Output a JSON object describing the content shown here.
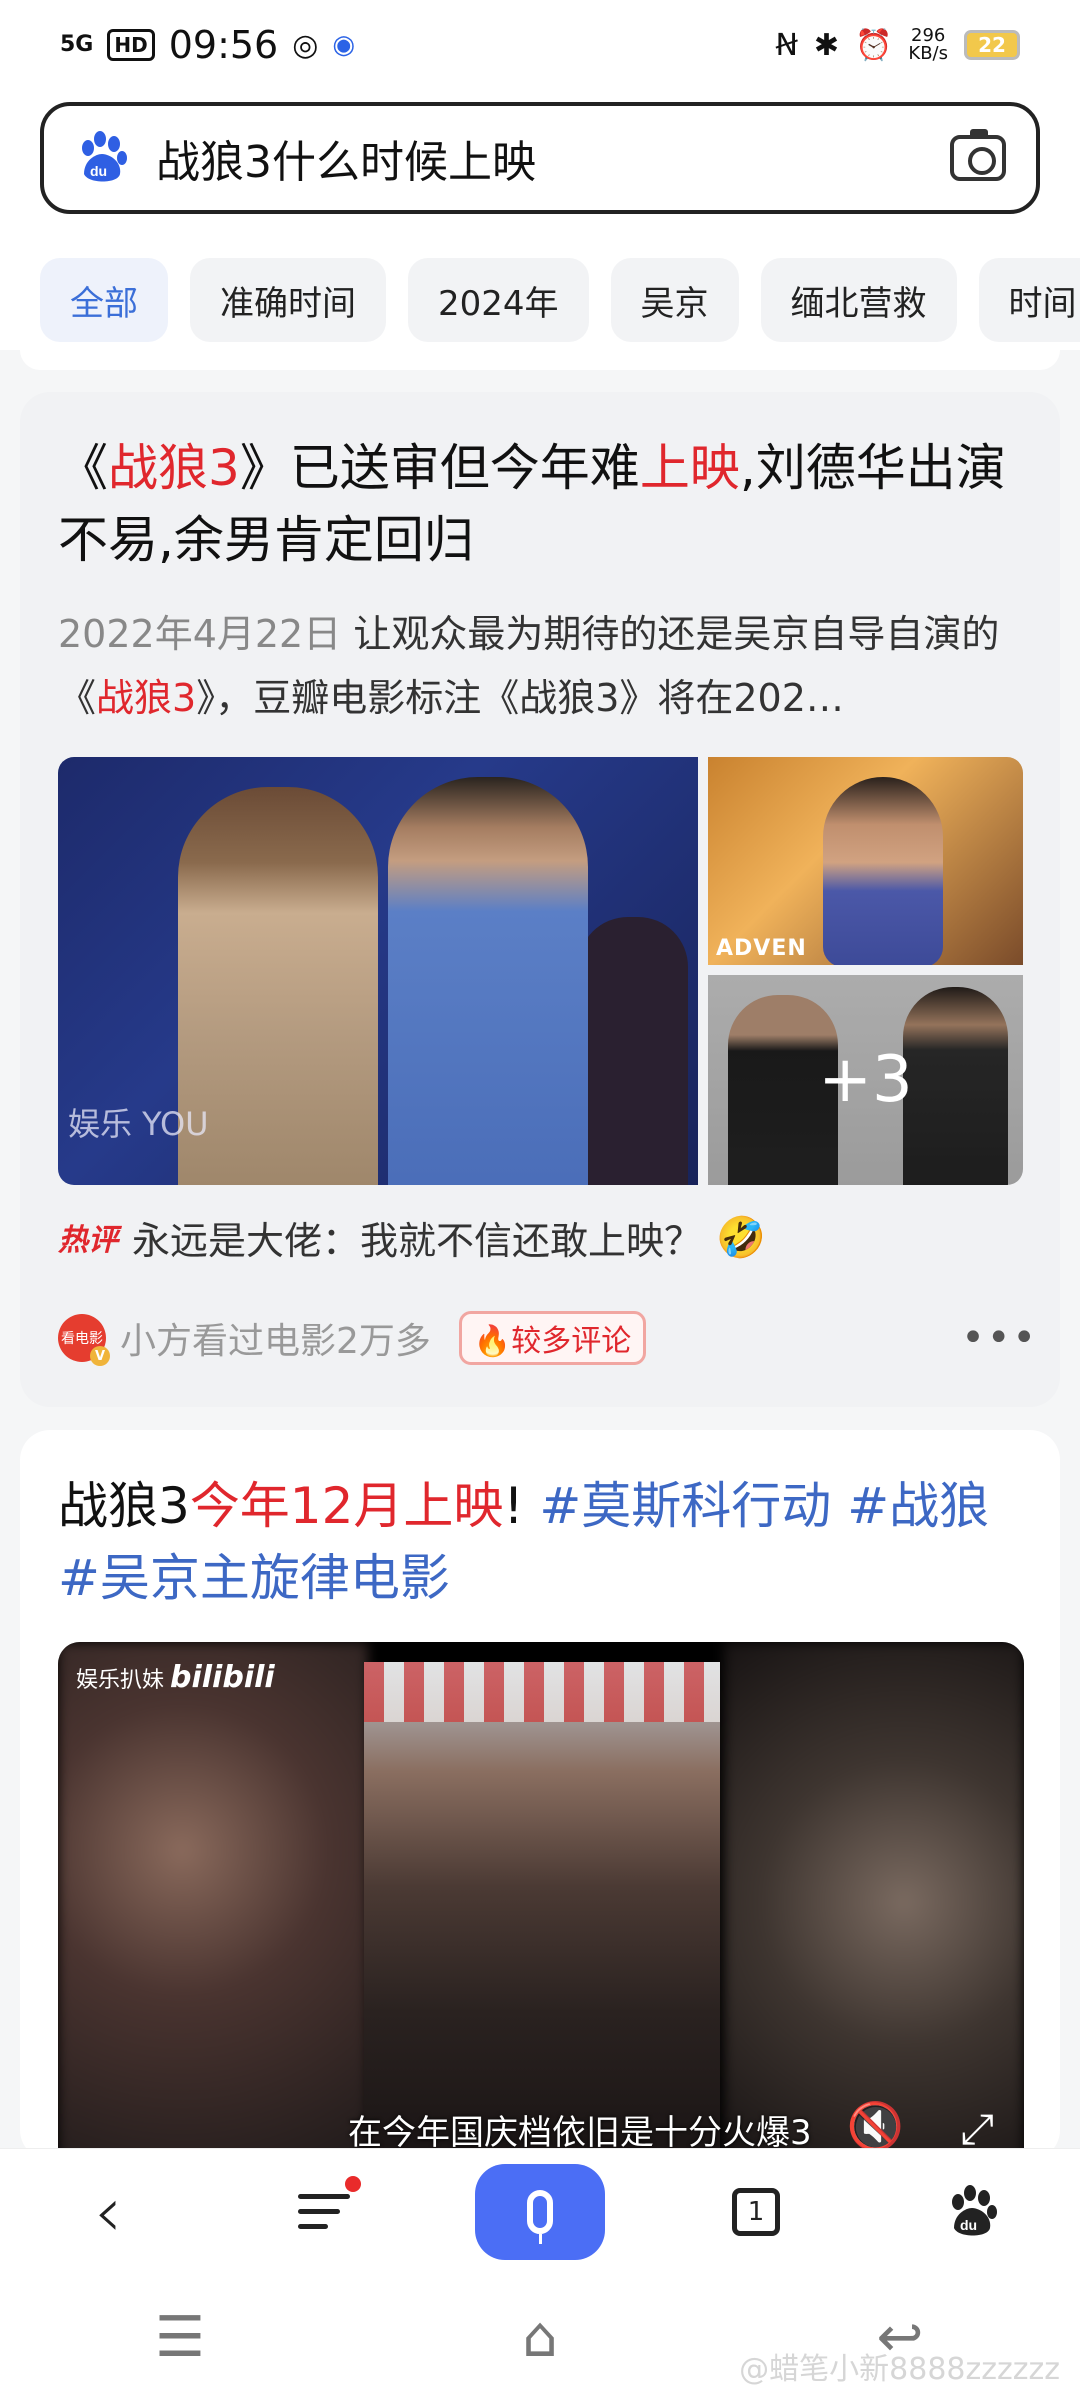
{
  "status_bar": {
    "network": "5G",
    "hd": "HD",
    "time": "09:56",
    "net_speed_value": "296",
    "net_speed_unit": "KB/s",
    "battery": "22"
  },
  "search": {
    "query": "战狼3什么时候上映"
  },
  "chips": [
    {
      "label": "全部",
      "active": true
    },
    {
      "label": "准确时间"
    },
    {
      "label": "2024年"
    },
    {
      "label": "吴京"
    },
    {
      "label": "缅北营救"
    },
    {
      "label": "时间"
    }
  ],
  "card1": {
    "title_parts": [
      "《",
      "战狼3",
      "》已送审但今年难",
      "上映",
      ",刘德华出演不易,余男肯定回归"
    ],
    "snippet_date": "2022年4月22日",
    "snippet_a": "让观众最为期待的还是吴京自导自演的《",
    "snippet_highlight": "战狼3",
    "snippet_b": "》，豆瓣电影标注《战狼3》将在202…",
    "img_big_watermark": "娱乐 YOU",
    "img_tr_text": "ADVEN",
    "img_br_more": "+3",
    "hot_tag": "热评",
    "hot_comment": "永远是大佬：我就不信还敢上映？",
    "hot_emoji": "🤣",
    "source_avatar_text": "看电影",
    "source_name": "小方看过电影2万多",
    "source_badge": "🔥较多评论"
  },
  "card2": {
    "title_a": "战狼3",
    "title_red": "今年12月上映",
    "title_b": "!",
    "tags": [
      "#莫斯科行动",
      "#战狼",
      "#吴京主旋律电影"
    ],
    "video_watermark_a": "娱乐扒妹",
    "video_watermark_b": "bilibili",
    "video_subtitle": "在今年国庆档依旧是十分火爆3"
  },
  "toolbar": {
    "tabs_count": "1"
  },
  "watermark": "@蜡笔小新8888zzzzzz"
}
